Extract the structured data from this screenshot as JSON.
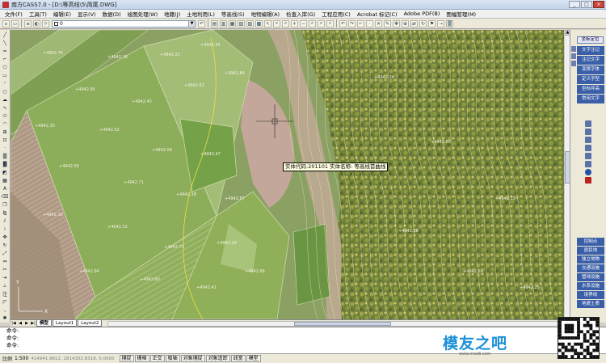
{
  "window": {
    "title": "南方CASS7.0 - [D:\\等高线\\5\\简尾.DWG]",
    "buttons": [
      "_",
      "□",
      "×"
    ]
  },
  "menu": [
    "文件(F)",
    "工具(T)",
    "编辑(E)",
    "显示(V)",
    "数据(D)",
    "绘图处理(W)",
    "地籍(J)",
    "土地利用(L)",
    "等高线(S)",
    "地物编辑(A)",
    "检查入库(G)",
    "工程应用(C)",
    "Acrobat 标记(C)",
    "Adobe PDF(B)",
    "图幅管理(M)"
  ],
  "toolbar": {
    "layer_value": "0"
  },
  "canvas": {
    "tooltip": "实体代码:201101 实体名称: 等高线首曲线",
    "elevations": [
      "4942.74",
      "4942.18",
      "4942.21",
      "4942.55",
      "4942.95",
      "4942.43",
      "4942.67",
      "4942.84",
      "4942.30",
      "4942.62",
      "4942.09",
      "4942.47",
      "4942.56",
      "4942.71",
      "4942.38",
      "4942.87",
      "4942.16",
      "4942.52",
      "4942.77",
      "4942.29",
      "4942.94",
      "4942.60",
      "4942.41",
      "4942.66",
      "4942.34",
      "4942.80",
      "4942.13",
      "4942.58",
      "4942.69",
      "4942.25"
    ]
  },
  "right_panel": {
    "title": "坐标定位",
    "items": [
      "文字注记",
      "注记文字",
      "变换字体",
      "定义字型",
      "坐标坪高",
      "常用文字"
    ],
    "items2": [
      "控制点",
      "居民地",
      "独立地物",
      "交通设施",
      "管线设施",
      "水系设施",
      "境界线",
      "地貌土质"
    ]
  },
  "tabs": [
    "模型",
    "Layout1",
    "Layout2"
  ],
  "command": {
    "lines": [
      "命令:",
      "命令:",
      "命令:"
    ]
  },
  "status": {
    "scale_label": "比例",
    "scale_value": "1:500",
    "coords": "414941.9812, 2814302.8318, 0.0000",
    "toggles": [
      "捕捉",
      "栅格",
      "正交",
      "极轴",
      "对象捕捉",
      "对象追踪",
      "线宽",
      "模型"
    ]
  },
  "watermark": {
    "text": "模友之吧",
    "url": "www.moz8.com"
  }
}
